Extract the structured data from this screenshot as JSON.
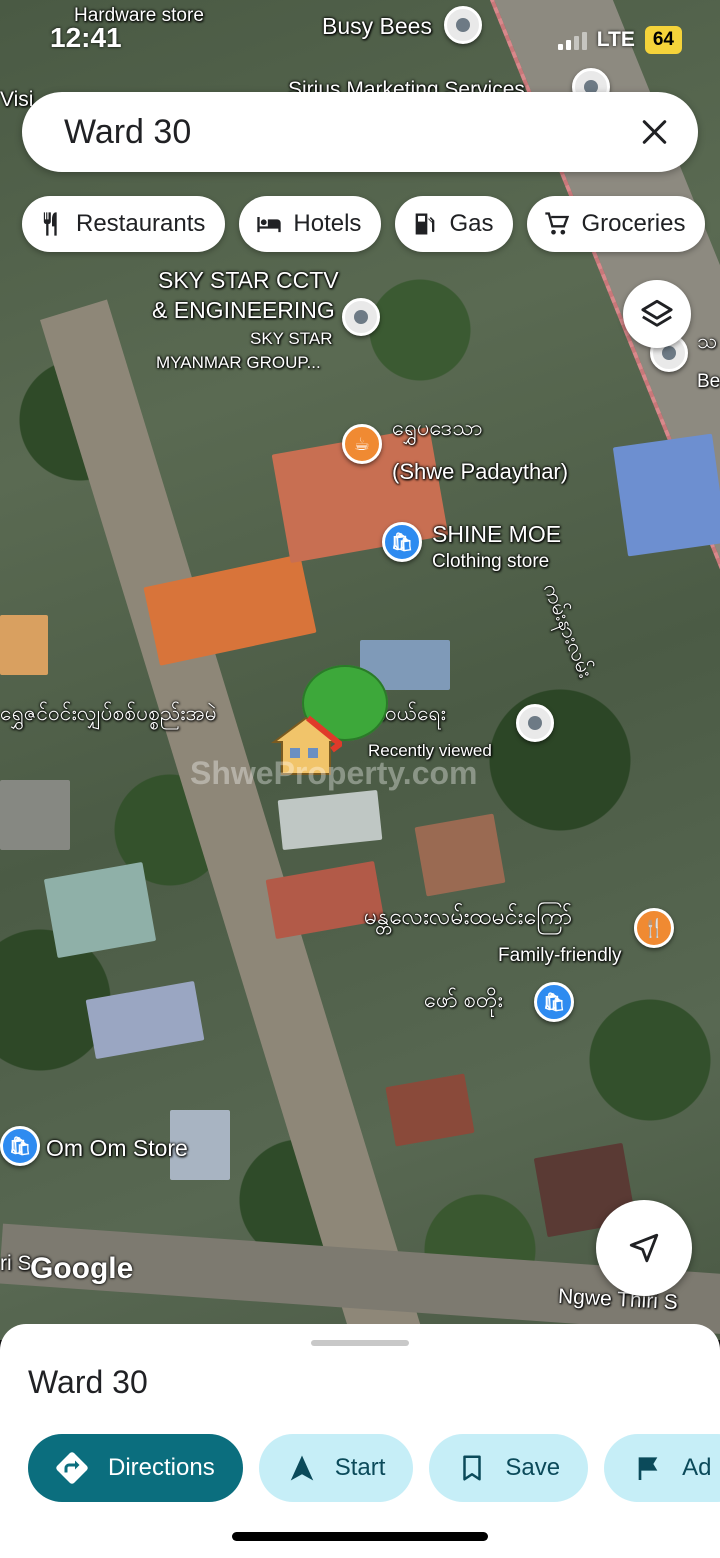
{
  "status_bar": {
    "time": "12:41",
    "network": "LTE",
    "battery": "64"
  },
  "search": {
    "query": "Ward 30"
  },
  "chips": [
    {
      "label": "Restaurants",
      "icon": "fork-knife-icon"
    },
    {
      "label": "Hotels",
      "icon": "bed-icon"
    },
    {
      "label": "Gas",
      "icon": "gas-pump-icon"
    },
    {
      "label": "Groceries",
      "icon": "cart-icon"
    }
  ],
  "map": {
    "labels": {
      "hardware_store": "Hardware store",
      "busy_bees": "Busy Bees",
      "sirius": "Sirius Marketing Services",
      "visi": "Visi",
      "sky_star_1": "SKY STAR CCTV",
      "sky_star_2": "& ENGINEERING",
      "sky_star_sub1": "SKY STAR",
      "sky_star_sub2": "MYANMAR GROUP...",
      "shwe_my": "ရွှေပဒေသာ",
      "shwe_en": "(Shwe Padaythar)",
      "shine_moe": "SHINE MOE",
      "clothing": "Clothing store",
      "road_vertical": "ကမ်းနားလမ်း",
      "shwe_property_row": "ရွှေဇင်ဝင်းလျှပ်စစ်ပစ္စည်းအမဲ",
      "row_suffix": "င်းဝယ်ရေး",
      "recently_viewed": "Recently viewed",
      "watermark": "ShweProperty.com",
      "mandalay": "မန္တလေးလမ်းထမင်းကြော်",
      "family": "Family-friendly",
      "phaw": "ဖော် စတိုး",
      "om_om": "Om Om Store",
      "ngwe_thiri": "Ngwe Thiri S",
      "ri_s": "ri S",
      "right_edge": "သ",
      "be": "Be",
      "google": "Google"
    }
  },
  "sheet": {
    "title": "Ward 30",
    "actions": [
      {
        "label": "Directions",
        "icon": "directions-icon"
      },
      {
        "label": "Start",
        "icon": "navigation-arrow-icon"
      },
      {
        "label": "Save",
        "icon": "bookmark-icon"
      },
      {
        "label": "Ad",
        "icon": "flag-icon"
      }
    ]
  },
  "colors": {
    "primary_button": "#0b6e7e",
    "secondary_button": "#c6eef7",
    "poi_blue": "#2e8bf0",
    "poi_orange": "#f08a32",
    "battery": "#f5d33a"
  }
}
